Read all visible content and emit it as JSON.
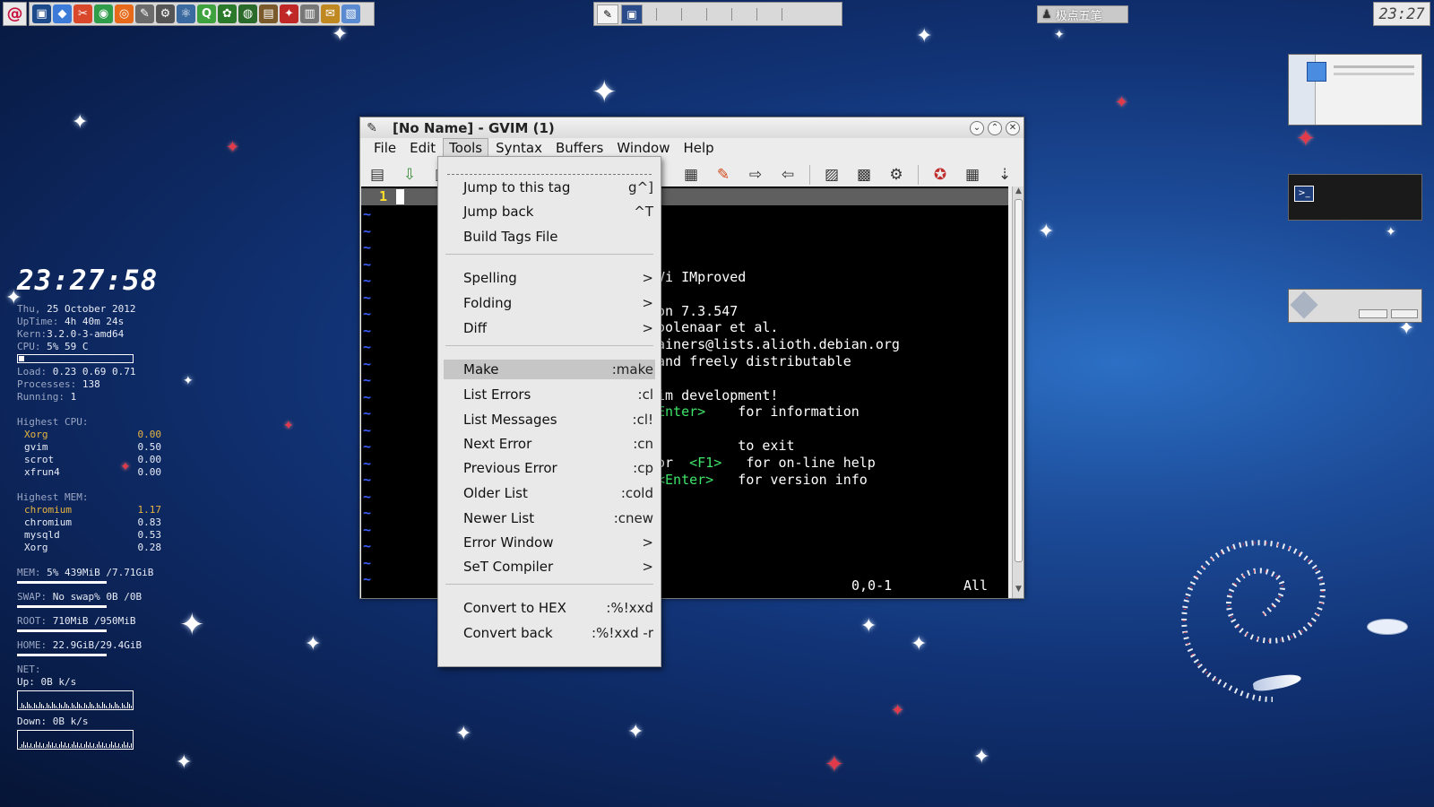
{
  "topbar": {
    "ime_label": "极点五笔",
    "clock": "23:27",
    "launcher_icons": [
      "terminal-icon",
      "shield-icon",
      "tools-icon",
      "chromium-icon",
      "firefox-icon",
      "file-manager-icon",
      "settings-icon",
      "network-icon",
      "qt-icon",
      "puzzle-icon",
      "gnome-icon",
      "book-icon",
      "office-icon",
      "printer-icon",
      "mail-icon",
      "image-viewer-icon"
    ]
  },
  "conky": {
    "time": "23:27:58",
    "date_label": "Thu,",
    "date": "25 October 2012",
    "uptime_label": "UpTime:",
    "uptime": "4h 40m 24s",
    "kern_label": "Kern:",
    "kern": "3.2.0-3-amd64",
    "cpu_label": "CPU:",
    "cpu": "5% 59 C",
    "cpu_fraction": 0.05,
    "load_label": "Load:",
    "load": "0.23 0.69 0.71",
    "processes_label": "Processes:",
    "processes": "138",
    "running_label": "Running:",
    "running": "1",
    "highest_cpu_label": "Highest CPU:",
    "highest_cpu": [
      {
        "name": "Xorg",
        "value": "0.00"
      },
      {
        "name": "gvim",
        "value": "0.50"
      },
      {
        "name": "scrot",
        "value": "0.00"
      },
      {
        "name": "xfrun4",
        "value": "0.00"
      }
    ],
    "highest_mem_label": "Highest MEM:",
    "highest_mem": [
      {
        "name": "chromium",
        "value": "1.17"
      },
      {
        "name": "chromium",
        "value": "0.83"
      },
      {
        "name": "mysqld",
        "value": "0.53"
      },
      {
        "name": "Xorg",
        "value": "0.28"
      }
    ],
    "mem_label": "MEM:",
    "mem": "5% 439MiB /7.71GiB",
    "swap_label": "SWAP:",
    "swap": "No swap% 0B     /0B",
    "root_label": "ROOT:",
    "root": "710MiB /950MiB",
    "home_label": "HOME:",
    "home": "22.9GiB/29.4GiB",
    "net_label": "NET:",
    "up_label": "Up:",
    "up": "0B      k/s",
    "down_label": "Down:",
    "down": "0B      k/s"
  },
  "gvim": {
    "title": "[No Name] - GVIM (1)",
    "menu": [
      "File",
      "Edit",
      "Tools",
      "Syntax",
      "Buffers",
      "Window",
      "Help"
    ],
    "line_number": "1",
    "intro_lines": [
      {
        "text": "Vi IMproved",
        "green": ""
      },
      {
        "text": "",
        "green": ""
      },
      {
        "text": "on 7.3.547",
        "green": ""
      },
      {
        "text": "oolenaar et al.",
        "green": ""
      },
      {
        "text": "ainers@lists.alioth.debian.org",
        "green": ""
      },
      {
        "text": "and freely distributable",
        "green": ""
      },
      {
        "text": "",
        "green": ""
      },
      {
        "text": "im development!",
        "green": ""
      },
      {
        "text": "    for information",
        "green": "Enter>"
      },
      {
        "text": "",
        "green": ""
      },
      {
        "text": "          to exit",
        "green": ""
      },
      {
        "text": "or       for on-line help",
        "green": "<F1>"
      },
      {
        "text": "   for version info",
        "green": "<Enter>"
      }
    ],
    "status_pos": "0,0-1",
    "status_all": "All"
  },
  "tools_menu": [
    {
      "label": "Jump to this tag",
      "shortcut": "g^]"
    },
    {
      "label": "Jump back",
      "shortcut": "^T"
    },
    {
      "label": "Build Tags File",
      "shortcut": ""
    },
    {
      "label": "Spelling",
      "shortcut": ">"
    },
    {
      "label": "Folding",
      "shortcut": ">"
    },
    {
      "label": "Diff",
      "shortcut": ">"
    },
    {
      "label": "Make",
      "shortcut": ":make"
    },
    {
      "label": "List Errors",
      "shortcut": ":cl"
    },
    {
      "label": "List Messages",
      "shortcut": ":cl!"
    },
    {
      "label": "Next Error",
      "shortcut": ":cn"
    },
    {
      "label": "Previous Error",
      "shortcut": ":cp"
    },
    {
      "label": "Older List",
      "shortcut": ":cold"
    },
    {
      "label": "Newer List",
      "shortcut": ":cnew"
    },
    {
      "label": "Error Window",
      "shortcut": ">"
    },
    {
      "label": "SeT Compiler",
      "shortcut": ">"
    },
    {
      "label": "Convert to HEX",
      "shortcut": ":%!xxd"
    },
    {
      "label": "Convert back",
      "shortcut": ":%!xxd -r"
    }
  ]
}
